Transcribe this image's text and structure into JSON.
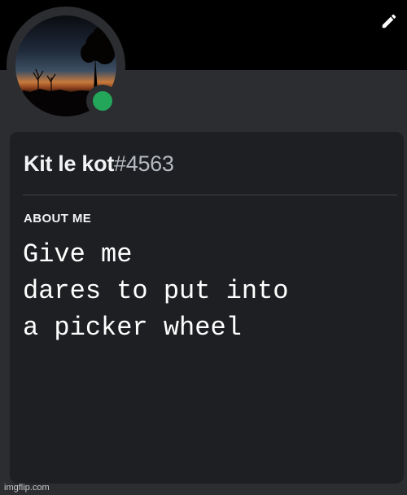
{
  "profile": {
    "username": "Kit le kot",
    "discriminator": "#4563",
    "status": "online",
    "status_color": "#23a55a"
  },
  "about": {
    "title": "ABOUT ME",
    "text": "Give me\ndares to put into\na picker wheel"
  },
  "icons": {
    "edit": "pencil-icon",
    "status": "online-status-icon"
  },
  "watermark": "imgflip.com"
}
